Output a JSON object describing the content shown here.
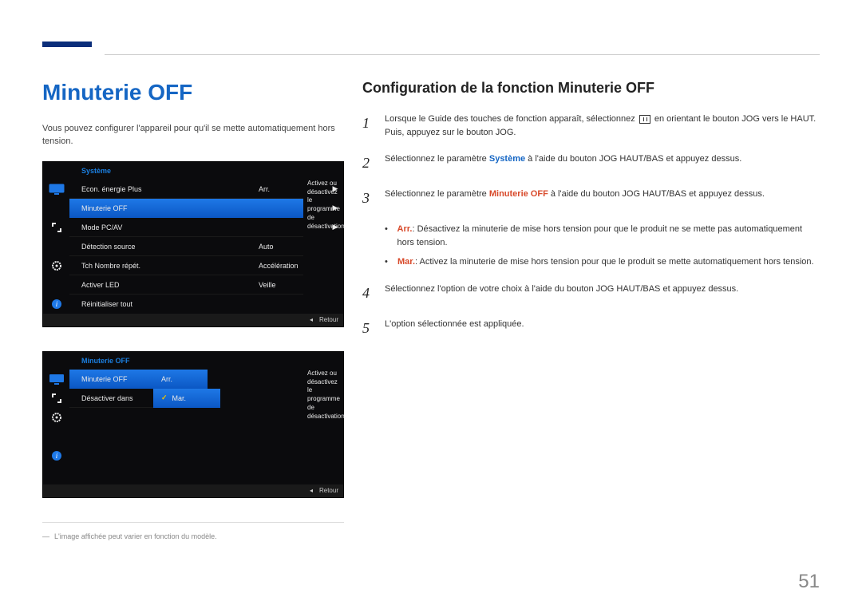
{
  "page_number": "51",
  "section_title": "Minuterie OFF",
  "intro_text": "Vous pouvez configurer l'appareil pour qu'il se mette automatiquement hors tension.",
  "osd1": {
    "header": "Système",
    "rows": [
      {
        "label": "Econ. énergie Plus",
        "value": "Arr.",
        "arrow": "▶"
      },
      {
        "label": "Minuterie OFF",
        "value": "",
        "arrow": "▶"
      },
      {
        "label": "Mode PC/AV",
        "value": "",
        "arrow": "▶"
      },
      {
        "label": "Détection source",
        "value": "Auto",
        "arrow": ""
      },
      {
        "label": "Tch Nombre répét.",
        "value": "Accélération",
        "arrow": ""
      },
      {
        "label": "Activer LED",
        "value": "Veille",
        "arrow": ""
      },
      {
        "label": "Réinitialiser tout",
        "value": "",
        "arrow": ""
      }
    ],
    "side_desc": "Activez ou désactivez le programme de désactivation.",
    "footer_back": "Retour"
  },
  "osd2": {
    "header": "Minuterie OFF",
    "rows": [
      {
        "label": "Minuterie OFF",
        "value": "Arr."
      },
      {
        "label": "Désactiver dans",
        "value": "Mar."
      }
    ],
    "side_desc": "Activez ou désactivez le programme de désactivation.",
    "footer_back": "Retour"
  },
  "footnote": "L'image affichée peut varier en fonction du modèle.",
  "sub_title": "Configuration de la fonction Minuterie OFF",
  "steps": {
    "s1a": "Lorsque le Guide des touches de fonction apparaît, sélectionnez ",
    "s1b": " en orientant le bouton JOG vers le HAUT. Puis, appuyez sur le bouton JOG.",
    "s2a": "Sélectionnez le paramètre ",
    "s2_kw": "Système",
    "s2b": " à l'aide du bouton JOG HAUT/BAS et appuyez dessus.",
    "s3a": "Sélectionnez le paramètre ",
    "s3_kw": "Minuterie OFF",
    "s3b": " à l'aide du bouton JOG HAUT/BAS et appuyez dessus.",
    "b1_kw": "Arr.",
    "b1": ": Désactivez la minuterie de mise hors tension pour que le produit ne se mette pas automatiquement hors tension.",
    "b2_kw": "Mar.",
    "b2": ": Activez la minuterie de mise hors tension pour que le produit se mette automatiquement hors tension.",
    "s4": "Sélectionnez l'option de votre choix à l'aide du bouton JOG HAUT/BAS et appuyez dessus.",
    "s5": "L'option sélectionnée est appliquée."
  },
  "numerals": {
    "n1": "1",
    "n2": "2",
    "n3": "3",
    "n4": "4",
    "n5": "5"
  },
  "triangle": "◂"
}
